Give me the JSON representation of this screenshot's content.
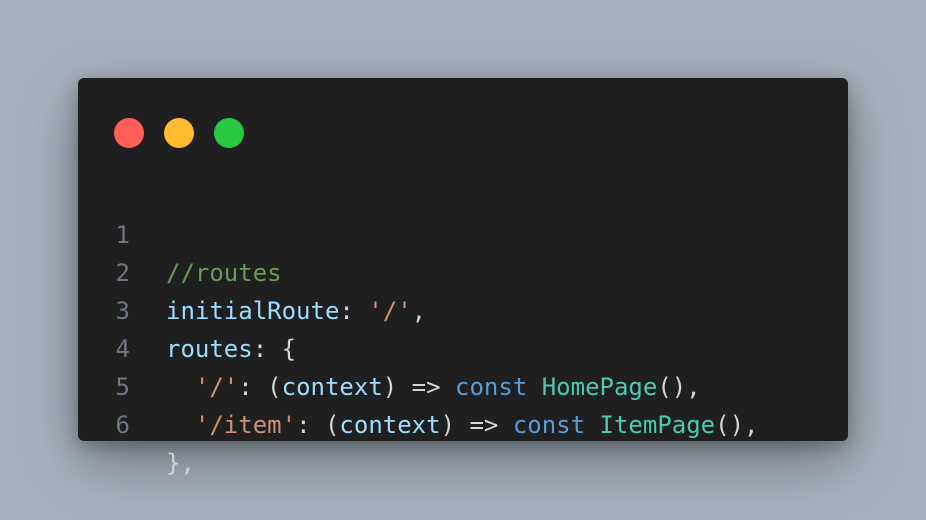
{
  "window": {
    "controls": {
      "close_color": "#ff5f57",
      "minimize_color": "#febc2e",
      "maximize_color": "#28c840"
    }
  },
  "code": {
    "lines": [
      {
        "number": "1",
        "tokens": [
          {
            "text": "//routes",
            "type": "comment"
          }
        ]
      },
      {
        "number": "2",
        "tokens": [
          {
            "text": "initialRoute",
            "type": "prop"
          },
          {
            "text": ": ",
            "type": "punct"
          },
          {
            "text": "'/'",
            "type": "string"
          },
          {
            "text": ",",
            "type": "punct"
          }
        ]
      },
      {
        "number": "3",
        "tokens": [
          {
            "text": "routes",
            "type": "prop"
          },
          {
            "text": ": {",
            "type": "punct"
          }
        ]
      },
      {
        "number": "4",
        "tokens": [
          {
            "text": "  ",
            "type": "punct"
          },
          {
            "text": "'/'",
            "type": "string"
          },
          {
            "text": ": (",
            "type": "punct"
          },
          {
            "text": "context",
            "type": "param"
          },
          {
            "text": ") => ",
            "type": "punct"
          },
          {
            "text": "const",
            "type": "keyword"
          },
          {
            "text": " ",
            "type": "punct"
          },
          {
            "text": "HomePage",
            "type": "class"
          },
          {
            "text": "(),",
            "type": "punct"
          }
        ]
      },
      {
        "number": "5",
        "tokens": [
          {
            "text": "  ",
            "type": "punct"
          },
          {
            "text": "'/item'",
            "type": "string"
          },
          {
            "text": ": (",
            "type": "punct"
          },
          {
            "text": "context",
            "type": "param"
          },
          {
            "text": ") => ",
            "type": "punct"
          },
          {
            "text": "const",
            "type": "keyword"
          },
          {
            "text": " ",
            "type": "punct"
          },
          {
            "text": "ItemPage",
            "type": "class"
          },
          {
            "text": "(),",
            "type": "punct"
          }
        ]
      },
      {
        "number": "6",
        "tokens": [
          {
            "text": "},",
            "type": "punct"
          }
        ]
      }
    ]
  }
}
